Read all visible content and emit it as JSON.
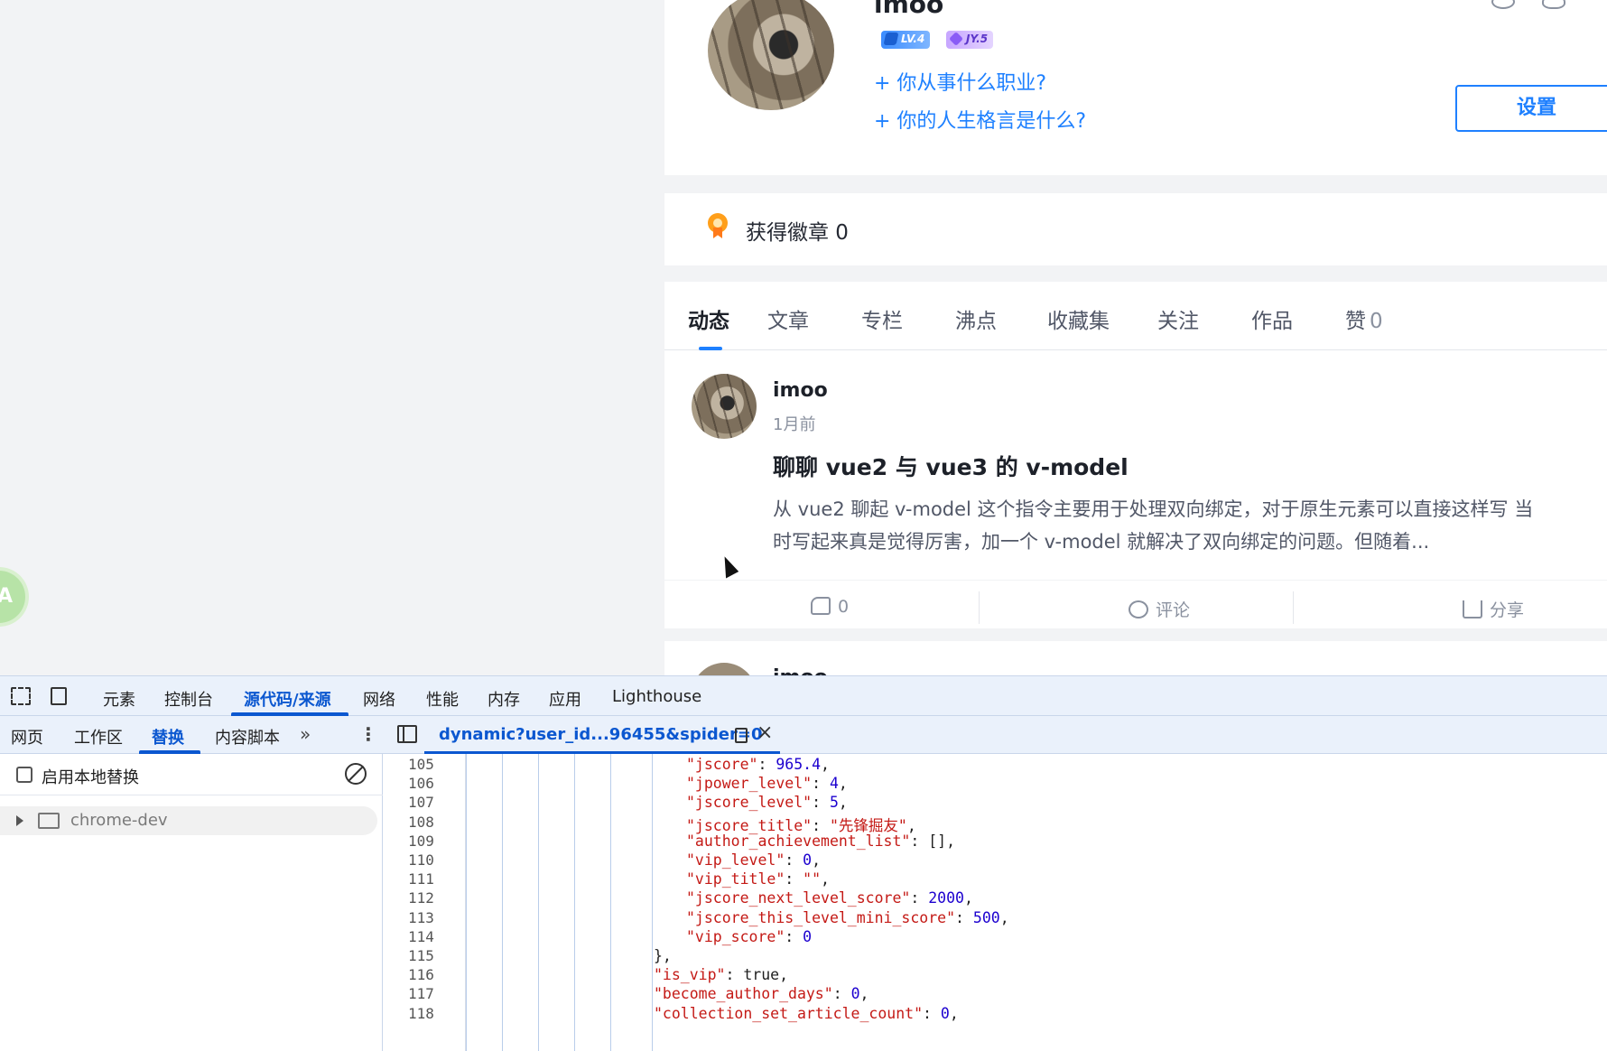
{
  "profile": {
    "username": "imoo",
    "level_badge": "LV.4",
    "jy_badge": "JY.5",
    "prompt_job": "+ 你从事什么职业?",
    "prompt_motto": "+ 你的人生格言是什么?",
    "settings_label": "设置"
  },
  "badges": {
    "text": "获得徽章 0"
  },
  "feed": {
    "tabs": [
      {
        "label": "动态",
        "active": true
      },
      {
        "label": "文章"
      },
      {
        "label": "专栏"
      },
      {
        "label": "沸点"
      },
      {
        "label": "收藏集"
      },
      {
        "label": "关注"
      },
      {
        "label": "作品"
      },
      {
        "label": "赞",
        "count": "0"
      }
    ],
    "post": {
      "author": "imoo",
      "time": "1月前",
      "title": "聊聊 vue2 与 vue3 的 v-model",
      "abstract_1": "从 vue2 聊起 v-model 这个指令主要用于处理双向绑定，对于原生元素可以直接这样写 当",
      "abstract_2": "时写起来真是觉得厉害，加一个 v-model 就解决了双向绑定的问题。但随着...",
      "like_count": "0",
      "comment_label": "评论",
      "share_label": "分享"
    },
    "next_author": "imoo"
  },
  "float_bubble": "A",
  "devtools": {
    "tabs": [
      "元素",
      "控制台",
      "源代码/来源",
      "网络",
      "性能",
      "内存",
      "应用",
      "Lighthouse"
    ],
    "active_tab": "源代码/来源",
    "sub_tabs": [
      "网页",
      "工作区",
      "替换",
      "内容脚本"
    ],
    "active_sub_tab": "替换",
    "overrides_label": "启用本地替换",
    "folder": "chrome-dev",
    "file_name": "dynamic?user_id...96455&spider=0",
    "code_lines": [
      {
        "ln": "105",
        "indent": 2,
        "key": "\"jscore\"",
        "sep": ": ",
        "val": "965.4",
        "vtype": "n",
        "tail": ","
      },
      {
        "ln": "106",
        "indent": 2,
        "key": "\"jpower_level\"",
        "sep": ": ",
        "val": "4",
        "vtype": "n",
        "tail": ","
      },
      {
        "ln": "107",
        "indent": 2,
        "key": "\"jscore_level\"",
        "sep": ": ",
        "val": "5",
        "vtype": "n",
        "tail": ","
      },
      {
        "ln": "108",
        "indent": 2,
        "key": "\"jscore_title\"",
        "sep": ": ",
        "val": "\"先锋掘友\"",
        "vtype": "k",
        "tail": ","
      },
      {
        "ln": "109",
        "indent": 2,
        "key": "\"author_achievement_list\"",
        "sep": ": ",
        "val": "[]",
        "vtype": "",
        "tail": ","
      },
      {
        "ln": "110",
        "indent": 2,
        "key": "\"vip_level\"",
        "sep": ": ",
        "val": "0",
        "vtype": "n",
        "tail": ","
      },
      {
        "ln": "111",
        "indent": 2,
        "key": "\"vip_title\"",
        "sep": ": ",
        "val": "\"\"",
        "vtype": "k",
        "tail": ","
      },
      {
        "ln": "112",
        "indent": 2,
        "key": "\"jscore_next_level_score\"",
        "sep": ": ",
        "val": "2000",
        "vtype": "n",
        "tail": ","
      },
      {
        "ln": "113",
        "indent": 2,
        "key": "\"jscore_this_level_mini_score\"",
        "sep": ": ",
        "val": "500",
        "vtype": "n",
        "tail": ","
      },
      {
        "ln": "114",
        "indent": 2,
        "key": "\"vip_score\"",
        "sep": ": ",
        "val": "0",
        "vtype": "n",
        "tail": ""
      },
      {
        "ln": "115",
        "indent": 1,
        "key": "",
        "sep": "",
        "val": "},",
        "vtype": "",
        "tail": ""
      },
      {
        "ln": "116",
        "indent": 1,
        "key": "\"is_vip\"",
        "sep": ": ",
        "val": "true",
        "vtype": "",
        "tail": ","
      },
      {
        "ln": "117",
        "indent": 1,
        "key": "\"become_author_days\"",
        "sep": ": ",
        "val": "0",
        "vtype": "n",
        "tail": ","
      },
      {
        "ln": "118",
        "indent": 1,
        "key": "\"collection_set_article_count\"",
        "sep": ": ",
        "val": "0",
        "vtype": "n",
        "tail": ","
      }
    ]
  }
}
